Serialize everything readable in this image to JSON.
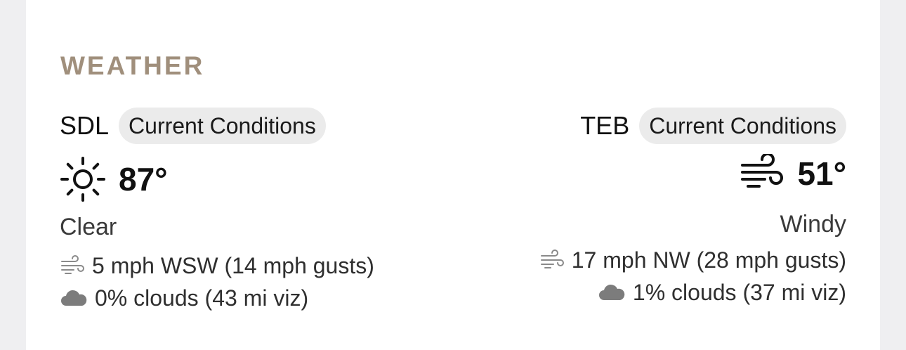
{
  "section": {
    "title": "WEATHER"
  },
  "stations": [
    {
      "code": "SDL",
      "badge": "Current Conditions",
      "icon": "sun-icon",
      "temperature": "87°",
      "condition": "Clear",
      "wind": "5 mph WSW (14 mph gusts)",
      "clouds": "0% clouds (43 mi viz)"
    },
    {
      "code": "TEB",
      "badge": "Current Conditions",
      "icon": "wind-icon",
      "temperature": "51°",
      "condition": "Windy",
      "wind": "17 mph NW (28 mph gusts)",
      "clouds": "1% clouds (37 mi viz)"
    }
  ],
  "colors": {
    "section_title": "#a08f7c",
    "badge_bg": "#ebebeb",
    "page_bg": "#efeff1",
    "card_bg": "#ffffff"
  }
}
